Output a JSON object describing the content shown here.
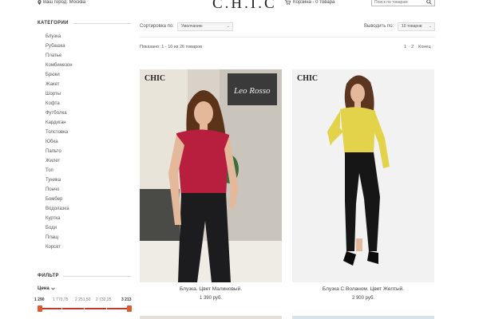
{
  "header": {
    "city": "Ваш город: Москва",
    "logo": "C.H.I.C",
    "cart": "Корзина - 0 товара",
    "search_placeholder": "Поиск по товарам"
  },
  "sidebar": {
    "categories_title": "КАТЕГОРИИ",
    "categories": [
      "Блузка",
      "Рубашка",
      "Платье",
      "Комбинезон",
      "Брюки",
      "Жакет",
      "Шорты",
      "Кофта",
      "Футболка",
      "Кардиган",
      "Толстовка",
      "Юбка",
      "Пальто",
      "Жилет",
      "Топ",
      "Туника",
      "Пончо",
      "Бомбер",
      "Водолазка",
      "Куртка",
      "Боди",
      "Плащ",
      "Корсет"
    ],
    "filter_title": "ФИЛЬТР",
    "price_label": "Цена",
    "price_ticks": [
      "1 290",
      "1 770,75",
      "2 251,50",
      "2 732,25",
      "3 213"
    ],
    "price_range": {
      "min": 1290,
      "max": 3213,
      "selected_min": 1290,
      "selected_max": 3213
    }
  },
  "toolbar": {
    "sort_label": "Сортировка по:",
    "sort_value": "Умолчанию",
    "per_page_label": "Выводить по:",
    "per_page_value": "10 товаров",
    "showing": "Показано: 1 - 10 из 26 товаров",
    "pages": [
      "1",
      "2",
      "Конец"
    ]
  },
  "products": [
    {
      "brand": "CHIC",
      "name": "Блузка. Цвет Малиновый.",
      "price": "1 390 руб."
    },
    {
      "brand": "CHIC",
      "name": "Блузка С Воланом. Цвет Желтый.",
      "price": "2 900 руб."
    }
  ],
  "colors": {
    "accent": "#c0392b",
    "slider_knob": "#e05a2b",
    "blouse_red": "#b81e3d",
    "blouse_yellow": "#e3d34a"
  }
}
